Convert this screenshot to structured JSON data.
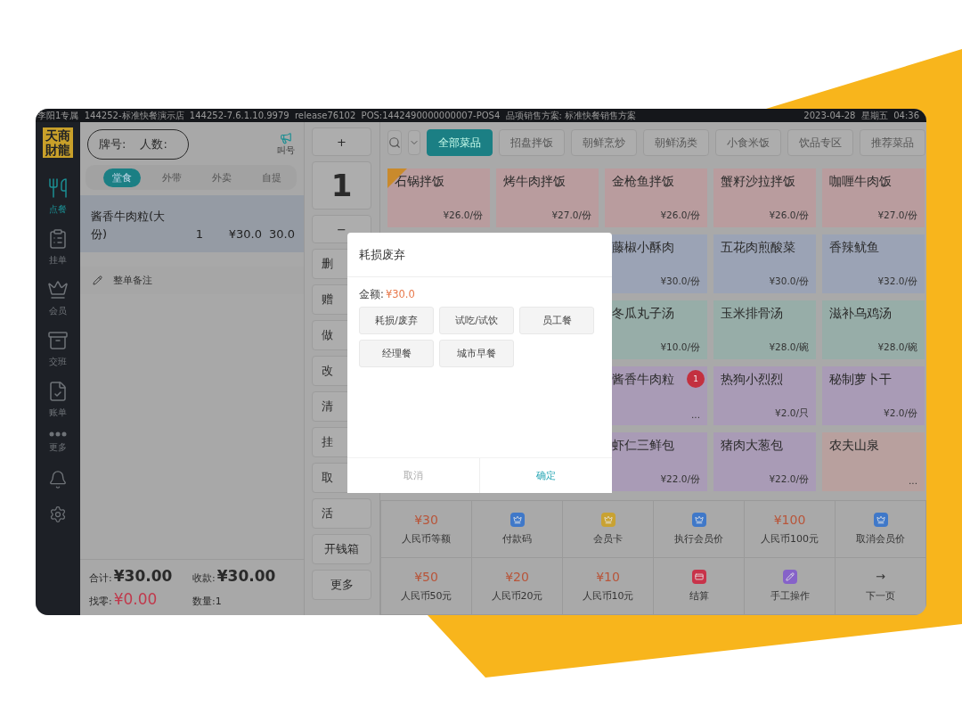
{
  "status_bar": {
    "left": "李阳1专属  144252-标准快餐演示店  144252-7.6.1.10.9979  release76102  POS:1442490000000007-POS4  品项销售方案: 标准快餐销售方案",
    "right": "2023-04-28  星期五  04:36"
  },
  "logo": "天商財龍",
  "nav": [
    {
      "label": "点餐",
      "selected": true
    },
    {
      "label": "挂单",
      "selected": false
    },
    {
      "label": "会员",
      "selected": false
    },
    {
      "label": "交班",
      "selected": false
    },
    {
      "label": "账单",
      "selected": false
    },
    {
      "label": "更多",
      "selected": false
    }
  ],
  "order": {
    "plate_label": "牌号:",
    "people_label": "人数:",
    "call_label": "叫号",
    "tabs": [
      {
        "label": "堂食",
        "selected": true
      },
      {
        "label": "外带",
        "selected": false
      },
      {
        "label": "外卖",
        "selected": false
      },
      {
        "label": "自提",
        "selected": false
      }
    ],
    "lines": [
      {
        "name": "酱香牛肉粒(大份)",
        "qty": "1",
        "price": "¥30.0",
        "total": "30.0",
        "selected": true
      }
    ],
    "note": "整单备注",
    "total_label": "合计:",
    "total": "¥30.00",
    "received_label": "收款:",
    "received": "¥30.00",
    "change_label": "找零:",
    "change": "¥0.00",
    "count": "数量:1"
  },
  "actions": [
    "+",
    "1",
    "−",
    "删",
    "赠",
    "做",
    "改",
    "清",
    "挂",
    "取",
    "活",
    "开钱箱",
    "更多"
  ],
  "categories": [
    {
      "label": "全部菜品",
      "selected": true
    },
    {
      "label": "招盘拌饭",
      "selected": false
    },
    {
      "label": "朝鲜烹炒",
      "selected": false
    },
    {
      "label": "朝鲜汤类",
      "selected": false
    },
    {
      "label": "小食米饭",
      "selected": false
    },
    {
      "label": "饮品专区",
      "selected": false
    },
    {
      "label": "推荐菜品",
      "selected": false
    }
  ],
  "dish_rows": [
    {
      "items": [
        {
          "name": "石锅拌饭",
          "price": "¥26.0/份",
          "color": "#b99c9e",
          "tag": true
        },
        {
          "name": "烤牛肉拌饭",
          "price": "¥27.0/份",
          "color": "#b99c9e"
        },
        {
          "name": "金枪鱼拌饭",
          "price": "¥26.0/份",
          "color": "#b99c9e"
        },
        {
          "name": "蟹籽沙拉拌饭",
          "price": "¥26.0/份",
          "color": "#b99c9e"
        },
        {
          "name": "咖喱牛肉饭",
          "price": "¥27.0/份",
          "color": "#b99c9e"
        }
      ]
    },
    {
      "items": [
        {
          "name": "藤椒小酥肉",
          "price": "¥30.0/份",
          "color": "#9ba3b5"
        },
        {
          "name": "五花肉煎酸菜",
          "price": "¥30.0/份",
          "color": "#9ba3b5"
        },
        {
          "name": "香辣鱿鱼",
          "price": "¥32.0/份",
          "color": "#9ba3b5"
        }
      ]
    },
    {
      "items": [
        {
          "name": "冬瓜丸子汤",
          "price": "¥10.0/份",
          "color": "#97ada8"
        },
        {
          "name": "玉米排骨汤",
          "price": "¥28.0/碗",
          "color": "#97ada8"
        },
        {
          "name": "滋补乌鸡汤",
          "price": "¥28.0/碗",
          "color": "#97ada8"
        }
      ]
    },
    {
      "items": [
        {
          "name": "酱香牛肉粒",
          "price": "...",
          "color": "#a99bb6",
          "badge": "1"
        },
        {
          "name": "热狗小烈烈",
          "price": "¥2.0/只",
          "color": "#a99bb6"
        },
        {
          "name": "秘制萝卜干",
          "price": "¥2.0/份",
          "color": "#a99bb6"
        }
      ]
    },
    {
      "items": [
        {
          "name": "虾仁三鲜包",
          "price": "¥22.0/份",
          "color": "#a99bb6"
        },
        {
          "name": "猪肉大葱包",
          "price": "¥22.0/份",
          "color": "#a99bb6"
        },
        {
          "name": "农夫山泉",
          "price": "...",
          "color": "#b8a09e"
        }
      ]
    }
  ],
  "payments": [
    {
      "kind": "amount",
      "amount": "¥30",
      "label": "人民币等额"
    },
    {
      "kind": "icon",
      "color": "#3f78c9",
      "label": "付款码"
    },
    {
      "kind": "icon",
      "color": "#c9a232",
      "label": "会员卡"
    },
    {
      "kind": "icon",
      "color": "#3f78c9",
      "label": "执行会员价"
    },
    {
      "kind": "amount",
      "amount": "¥100",
      "label": "人民币100元"
    },
    {
      "kind": "icon",
      "color": "#3f78c9",
      "label": "取消会员价"
    },
    {
      "kind": "amount",
      "amount": "¥50",
      "label": "人民币50元"
    },
    {
      "kind": "amount",
      "amount": "¥20",
      "label": "人民币20元"
    },
    {
      "kind": "amount",
      "amount": "¥10",
      "label": "人民币10元"
    },
    {
      "kind": "icon",
      "color": "#c8334a",
      "label": "结算"
    },
    {
      "kind": "icon",
      "color": "#8662c9",
      "label": "手工操作"
    },
    {
      "kind": "arrow",
      "amount": "→",
      "label": "下一页"
    }
  ],
  "dialog": {
    "title": "耗损废弃",
    "amount_label": "金额:",
    "amount": "¥30.0",
    "options": [
      "耗损/废弃",
      "试吃/试饮",
      "员工餐",
      "经理餐",
      "城市早餐"
    ],
    "cancel": "取消",
    "confirm": "确定"
  }
}
